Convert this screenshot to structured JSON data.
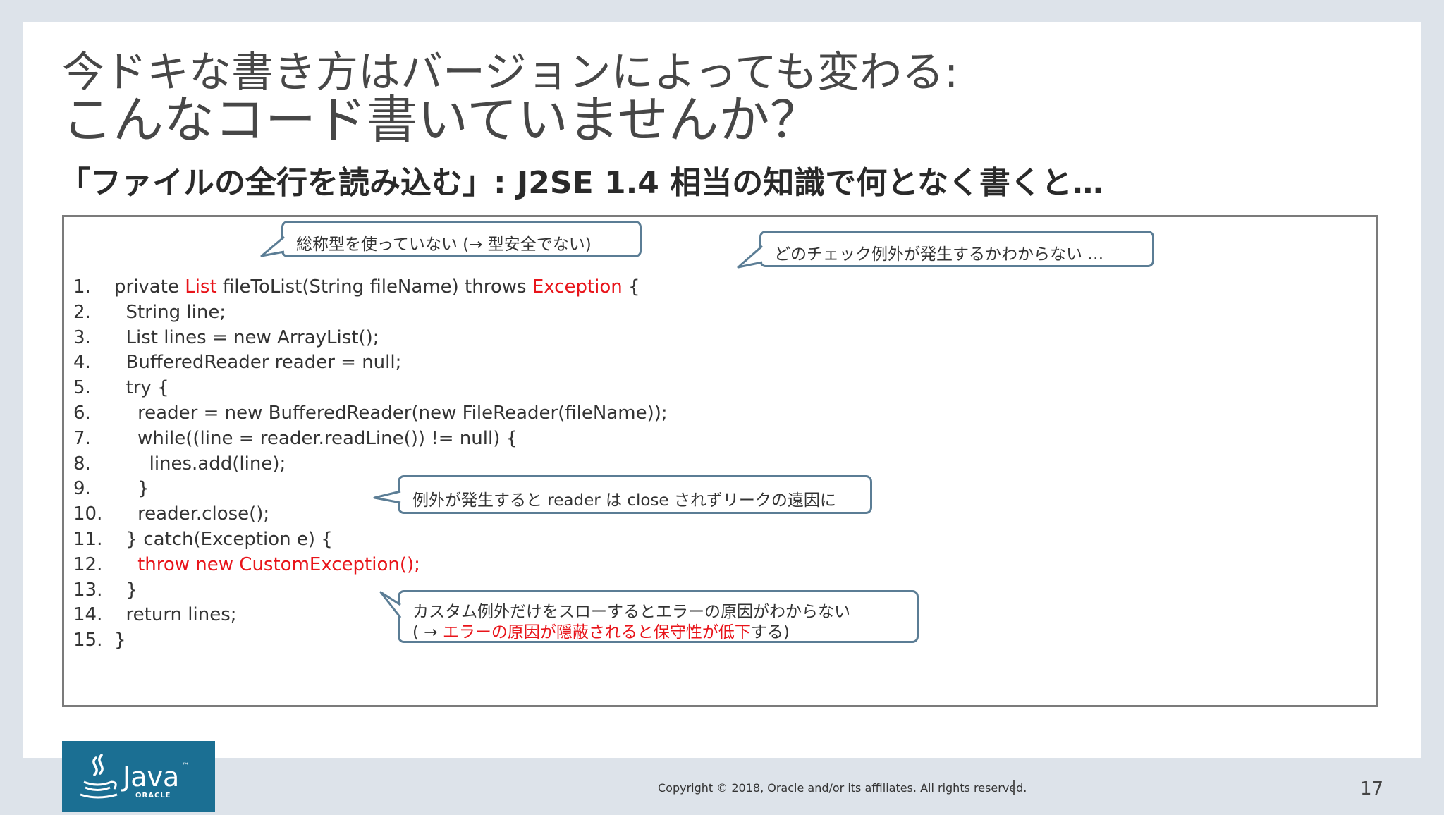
{
  "slide": {
    "title_line1": "今ドキな書き方はバージョンによっても変わる:",
    "title_line2": "こんなコード書いていませんか？",
    "subtitle": "「ファイルの全行を読み込む」: J2SE 1.4 相当の知識で何となく書くと…"
  },
  "code": {
    "lines": [
      {
        "num": "1.",
        "indent": "",
        "parts": [
          {
            "t": "private "
          },
          {
            "t": "List",
            "red": true
          },
          {
            "t": " fileToList(String fileName) throws "
          },
          {
            "t": "Exception",
            "red": true
          },
          {
            "t": " {"
          }
        ]
      },
      {
        "num": "2.",
        "indent": "  ",
        "parts": [
          {
            "t": "String line;"
          }
        ]
      },
      {
        "num": "3.",
        "indent": "  ",
        "parts": [
          {
            "t": "List lines = new ArrayList();"
          }
        ]
      },
      {
        "num": "4.",
        "indent": "  ",
        "parts": [
          {
            "t": "BufferedReader reader = null;"
          }
        ]
      },
      {
        "num": "5.",
        "indent": "  ",
        "parts": [
          {
            "t": "try {"
          }
        ]
      },
      {
        "num": "6.",
        "indent": "    ",
        "parts": [
          {
            "t": "reader = new BufferedReader(new FileReader(fileName));"
          }
        ]
      },
      {
        "num": "7.",
        "indent": "    ",
        "parts": [
          {
            "t": "while((line = reader.readLine()) != null) {"
          }
        ]
      },
      {
        "num": "8.",
        "indent": "      ",
        "parts": [
          {
            "t": "lines.add(line);"
          }
        ]
      },
      {
        "num": "9.",
        "indent": "    ",
        "parts": [
          {
            "t": "}"
          }
        ]
      },
      {
        "num": "10.",
        "indent": "    ",
        "parts": [
          {
            "t": "reader.close();"
          }
        ]
      },
      {
        "num": "11.",
        "indent": "  ",
        "parts": [
          {
            "t": "} catch(Exception e) {"
          }
        ]
      },
      {
        "num": "12.",
        "indent": "    ",
        "parts": [
          {
            "t": "throw new CustomException();",
            "red": true
          }
        ]
      },
      {
        "num": "13.",
        "indent": "  ",
        "parts": [
          {
            "t": "}"
          }
        ]
      },
      {
        "num": "14.",
        "indent": "  ",
        "parts": [
          {
            "t": "return lines;"
          }
        ]
      },
      {
        "num": "15.",
        "indent": "",
        "parts": [
          {
            "t": "}"
          }
        ]
      }
    ]
  },
  "callouts": {
    "generics": "総称型を使っていない (→ 型安全でない)",
    "checked_exceptions": "どのチェック例外が発生するかわからない …",
    "resource_leak": "例外が発生すると reader は close されずリークの遠因に",
    "custom_exception_line1": "カスタム例外だけをスローするとエラーの原因がわからない",
    "custom_exception_line2_prefix": "( → ",
    "custom_exception_line2_red": "エラーの原因が隠蔽されると保守性が低下",
    "custom_exception_line2_suffix": "する)"
  },
  "footer": {
    "logo_text": "Java",
    "logo_tm": "™",
    "logo_sub": "ORACLE",
    "copyright": "Copyright © 2018, Oracle and/or its affiliates. All rights reserved.",
    "page_number": "17"
  },
  "colors": {
    "accent_red": "#e8141a",
    "callout_border": "#5b7d95",
    "java_blue": "#1b6f93"
  }
}
